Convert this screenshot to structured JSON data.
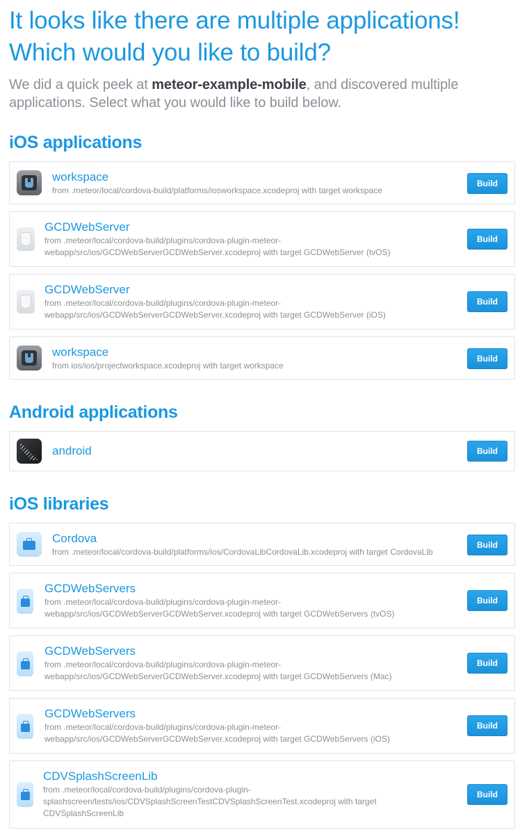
{
  "header": {
    "headline_line1": "It looks like there are multiple applications!",
    "headline_line2": "Which would you like to build?",
    "intro_prefix": "We did a quick peek at ",
    "intro_repo": "meteor-example-mobile",
    "intro_suffix": ", and discovered multiple applications. Select what you would like to build below."
  },
  "sections": {
    "ios_apps": {
      "title": "iOS applications",
      "items": [
        {
          "name": "workspace",
          "path": "from .meteor/local/cordova-build/platforms/iosworkspace.xcodeproj with target workspace",
          "icon": "xcode-workspace-icon",
          "button": "Build"
        },
        {
          "name": "GCDWebServer",
          "path": "from .meteor/local/cordova-build/plugins/cordova-plugin-meteor-webapp/src/ios/GCDWebServerGCDWebServer.xcodeproj with target GCDWebServer (tvOS)",
          "icon": "gcdwebserver-icon",
          "button": "Build"
        },
        {
          "name": "GCDWebServer",
          "path": "from .meteor/local/cordova-build/plugins/cordova-plugin-meteor-webapp/src/ios/GCDWebServerGCDWebServer.xcodeproj with target GCDWebServer (iOS)",
          "icon": "gcdwebserver-icon",
          "button": "Build"
        },
        {
          "name": "workspace",
          "path": "from ios/ios/projectworkspace.xcodeproj with target workspace",
          "icon": "xcode-workspace-icon",
          "button": "Build"
        }
      ]
    },
    "android_apps": {
      "title": "Android applications",
      "items": [
        {
          "name": "android",
          "icon": "meteor-android-icon",
          "button": "Build"
        }
      ]
    },
    "ios_libs": {
      "title": "iOS libraries",
      "items": [
        {
          "name": "Cordova",
          "path": "from .meteor/local/cordova-build/platforms/ios/CordovaLibCordovaLib.xcodeproj with target CordovaLib",
          "icon": "briefcase-icon",
          "button": "Build"
        },
        {
          "name": "GCDWebServers",
          "path": "from .meteor/local/cordova-build/plugins/cordova-plugin-meteor-webapp/src/ios/GCDWebServerGCDWebServer.xcodeproj with target GCDWebServers (tvOS)",
          "icon": "briefcase-icon",
          "button": "Build"
        },
        {
          "name": "GCDWebServers",
          "path": "from .meteor/local/cordova-build/plugins/cordova-plugin-meteor-webapp/src/ios/GCDWebServerGCDWebServer.xcodeproj with target GCDWebServers (Mac)",
          "icon": "briefcase-icon",
          "button": "Build"
        },
        {
          "name": "GCDWebServers",
          "path": "from .meteor/local/cordova-build/plugins/cordova-plugin-meteor-webapp/src/ios/GCDWebServerGCDWebServer.xcodeproj with target GCDWebServers (iOS)",
          "icon": "briefcase-icon",
          "button": "Build"
        },
        {
          "name": "CDVSplashScreenLib",
          "path": "from .meteor/local/cordova-build/plugins/cordova-plugin-splashscreen/tests/ios/CDVSplashScreenTestCDVSplashScreenTest.xcodeproj with target CDVSplashScreenLib",
          "icon": "briefcase-icon",
          "button": "Build"
        }
      ]
    }
  },
  "colors": {
    "accent": "#1a98e0",
    "button": "#1b92dc",
    "muted_text": "#8a8f96",
    "border": "#dfe3e7"
  }
}
